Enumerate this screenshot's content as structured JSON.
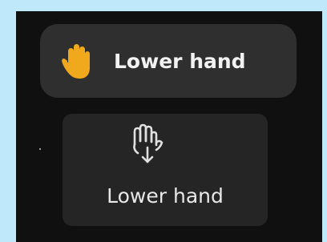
{
  "toast": {
    "icon": "raised-hand-icon",
    "label": "Lower hand",
    "icon_color": "#f0a81c"
  },
  "toolbar_button": {
    "icon": "lower-hand-icon",
    "label": "Lower hand"
  }
}
